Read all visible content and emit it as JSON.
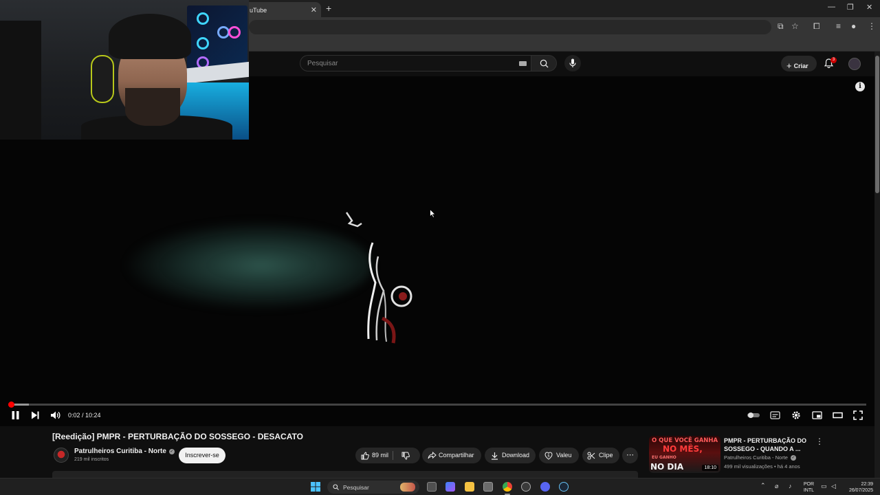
{
  "browser": {
    "tab_title": "uTube",
    "tab_close": "✕",
    "new_tab": "+",
    "window_controls": [
      "—",
      "❐",
      "✕"
    ]
  },
  "masthead": {
    "search_placeholder": "Pesquisar",
    "create_label": "Criar",
    "notifications_count": "3"
  },
  "player": {
    "current_time": "0:02",
    "duration": "10:24",
    "time_display": "0:02 / 10:24",
    "played_fraction": 0.003,
    "buffered_fraction": 0.024,
    "state": "playing"
  },
  "video": {
    "title": "[Reedição] PMPR - PERTURBAÇÃO DO SOSSEGO - DESACATO",
    "channel": "Patrulheiros Curitiba - Norte",
    "subscribers": "219 mil inscritos",
    "subscribe_label": "Inscrever-se",
    "likes": "89 mil",
    "share_label": "Compartilhar",
    "download_label": "Download",
    "thanks_label": "Valeu",
    "clip_label": "Clipe",
    "more_label": "⋯"
  },
  "recommended": [
    {
      "title": "PMPR - PERTURBAÇÃO DO SOSSEGO - QUANDO A ...",
      "channel": "Patrulheiros Curitiba - Norte",
      "meta": "499 mil visualizações • há 4 anos",
      "duration": "18:10",
      "thumb_lines": [
        "O QUE VOCÊ GANHA",
        "NO MÊS,",
        "EU GANHO",
        "NO DIA"
      ]
    }
  ],
  "taskbar": {
    "search_label": "Pesquisar",
    "lang_line1": "POR",
    "lang_line2": "INTL",
    "time": "22:39",
    "date": "26/07/2025"
  },
  "colors": {
    "accent_red": "#ff0000",
    "background": "#0f0f0f",
    "pill_bg": "#272727"
  }
}
